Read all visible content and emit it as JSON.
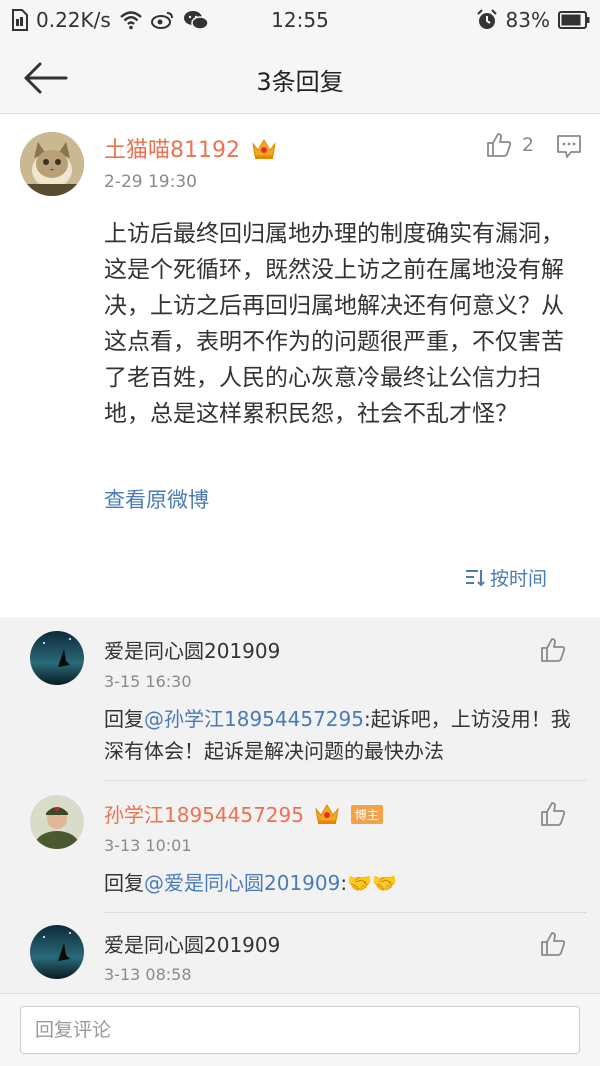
{
  "status_bar": {
    "speed": "0.22K/s",
    "time": "12:55",
    "battery": "83%"
  },
  "nav": {
    "title": "3条回复"
  },
  "main_comment": {
    "username": "土猫喵81192",
    "time": "2-29 19:30",
    "like_count": "2",
    "text": "上访后最终回归属地办理的制度确实有漏洞，这是个死循环，既然没上访之前在属地没有解决，上访之后再回归属地解决还有何意义？从这点看，表明不作为的问题很严重，不仅害苦了老百姓，人民的心灰意冷最终让公信力扫地，总是这样累积民怨，社会不乱才怪？",
    "view_original": "查看原微博",
    "sort_label": "按时间"
  },
  "replies": [
    {
      "username": "爱是同心圆201909",
      "time": "3-15 16:30",
      "prefix": "回复",
      "mention": "@孙学江18954457295",
      "text": ":起诉吧，上访没用！我深有体会！起诉是解决问题的最快办法"
    },
    {
      "username": "孙学江18954457295",
      "badge": "博主",
      "time": "3-13 10:01",
      "prefix": "回复",
      "mention": "@爱是同心圆201909",
      "text": ":🤝🤝"
    },
    {
      "username": "爱是同心圆201909",
      "time": "3-13 08:58"
    }
  ],
  "input": {
    "placeholder": "回复评论"
  },
  "colors": {
    "accent_orange": "#eb7350",
    "link_blue": "#4a7bb7"
  }
}
